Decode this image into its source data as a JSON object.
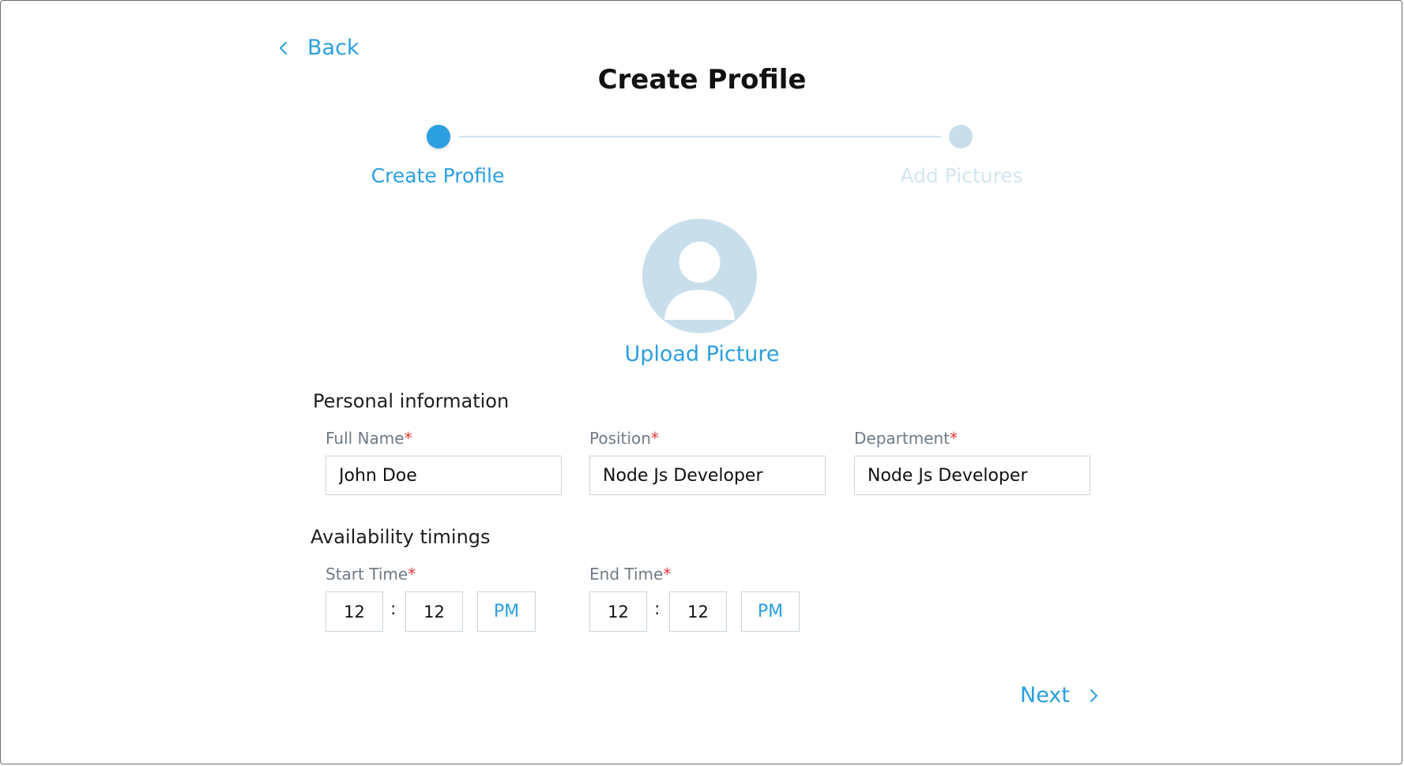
{
  "nav": {
    "back_label": "Back",
    "next_label": "Next"
  },
  "page": {
    "title": "Create Profile"
  },
  "stepper": {
    "steps": [
      {
        "label": "Create Profile",
        "state": "active"
      },
      {
        "label": "Add Pictures",
        "state": "inactive"
      }
    ]
  },
  "avatar": {
    "icon": "user-avatar-icon",
    "upload_label": "Upload Picture"
  },
  "personal": {
    "section_title": "Personal information",
    "fields": [
      {
        "label": "Full Name",
        "required_mark": "*",
        "value": "John Doe"
      },
      {
        "label": "Position",
        "required_mark": "*",
        "value": "Node Js Developer"
      },
      {
        "label": "Department",
        "required_mark": "*",
        "value": "Node Js Developer"
      }
    ]
  },
  "availability": {
    "section_title": "Availability timings",
    "start": {
      "label": "Start Time",
      "required_mark": "*",
      "hour": "12",
      "minute": "12",
      "separator": ":",
      "ampm": "PM"
    },
    "end": {
      "label": "End Time",
      "required_mark": "*",
      "hour": "12",
      "minute": "12",
      "separator": ":",
      "ampm": "PM"
    }
  },
  "colors": {
    "accent": "#2b9fe0",
    "inactive_step": "#c8dfeb",
    "required": "#e53935",
    "border": "#c9d4dc"
  }
}
